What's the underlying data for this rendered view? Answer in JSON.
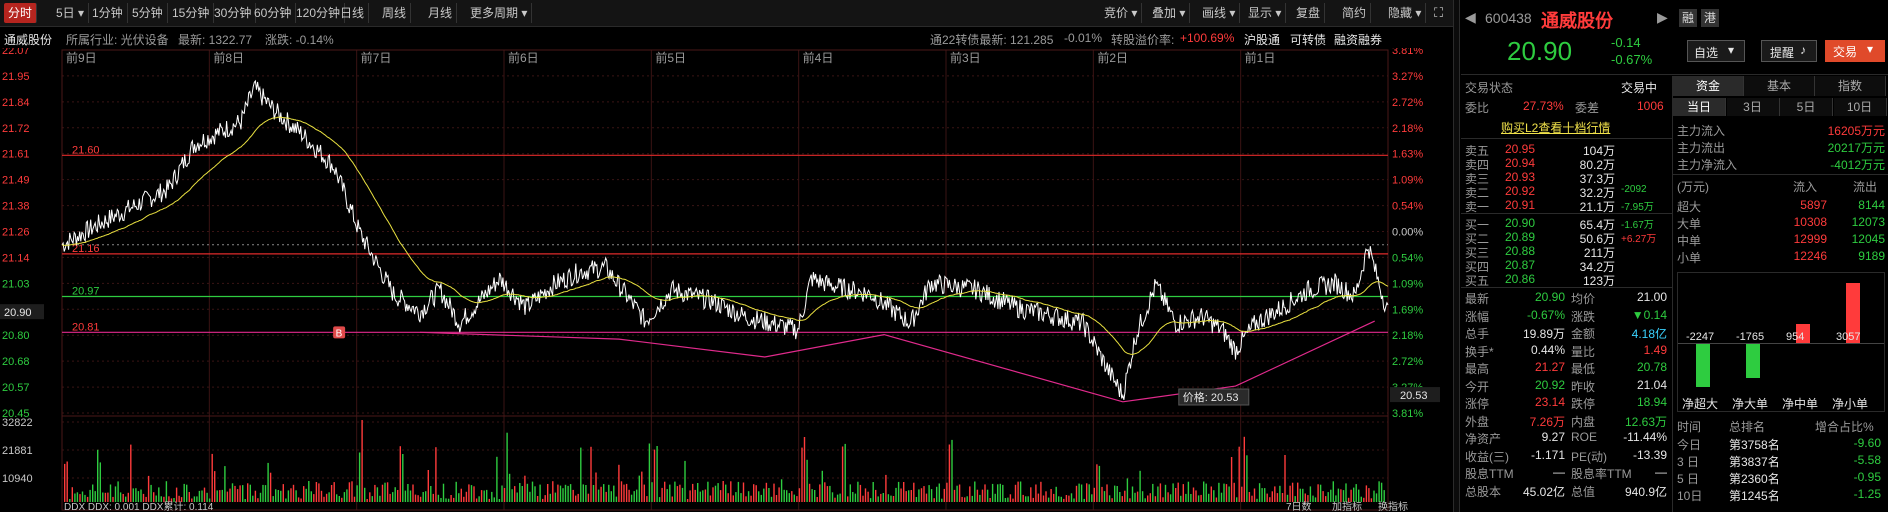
{
  "toolbar": {
    "left": [
      "分时",
      "5日",
      "1分钟",
      "5分钟",
      "15分钟",
      "30分钟",
      "60分钟",
      "120分钟",
      "日线",
      "周线",
      "月线",
      "更多周期"
    ],
    "right": [
      "竞价",
      "叠加",
      "画线",
      "显示",
      "复盘",
      "简约",
      "隐藏"
    ]
  },
  "infobar": {
    "name": "通威股份",
    "industry": "所属行业: 光伏设备",
    "latest": "最新: 1322.77",
    "change": "涨跌: -0.14%",
    "conv": "通22转债最新: 121.285",
    "conv_change": "-0.01%",
    "premium_label": "转股溢价率:",
    "premium": "+100.69%",
    "hk": "沪股通",
    "kz": "可转债",
    "rz": "融资融券"
  },
  "chart": {
    "day_labels": [
      "前9日",
      "前8日",
      "前7日",
      "前6日",
      "前5日",
      "前4日",
      "前3日",
      "前2日",
      "前1日"
    ],
    "price_ticks": [
      "22.07",
      "21.95",
      "21.84",
      "21.72",
      "21.61",
      "21.49",
      "21.38",
      "21.26",
      "21.14",
      "21.03",
      "20.90",
      "20.80",
      "20.68",
      "20.57",
      "20.45"
    ],
    "pct_ticks": [
      "3.81%",
      "3.27%",
      "2.72%",
      "2.18%",
      "1.63%",
      "1.09%",
      "0.54%",
      "0.00%",
      "0.54%",
      "1.09%",
      "1.69%",
      "2.18%",
      "2.72%",
      "3.27%",
      "3.81%"
    ],
    "price_min": 20.45,
    "price_max": 22.07,
    "level_labels": [
      "21.60",
      "21.16",
      "20.97",
      "20.81"
    ],
    "current_price": "20.90",
    "cursor_price": "20.53",
    "tooltip": "价格: 20.53",
    "b_marker": "B",
    "vol_ticks": [
      "32822",
      "21881",
      "10940"
    ],
    "bottom_left": "DDX  DDX: 0.001  DDX累计: 0.114",
    "bottom_right": [
      "7日数",
      "加指标",
      "换指标"
    ],
    "colors": {
      "up": "#ff3b3b",
      "down": "#2ecc40",
      "avg": "#e8e040",
      "level_red": "#e02a2a",
      "level_green": "#2ecc40",
      "level_magenta": "#e02a8c"
    }
  },
  "stock": {
    "code": "600438",
    "name": "通威股份",
    "tag1": "融",
    "tag2": "港",
    "price": "20.90",
    "change": "-0.14",
    "change_pct": "-0.67%",
    "watch_btn": "自选",
    "alert_btn": "提醒",
    "trade_btn": "交易"
  },
  "status": {
    "label": "交易状态",
    "value": "交易中",
    "ratio_label": "委比",
    "ratio": "27.73%",
    "diff_label": "委差",
    "diff": "1006",
    "l2": "购买L2查看十档行情"
  },
  "asks": [
    {
      "label": "卖五",
      "price": "20.95",
      "vol": "104万",
      "delta": ""
    },
    {
      "label": "卖四",
      "price": "20.94",
      "vol": "80.2万",
      "delta": ""
    },
    {
      "label": "卖三",
      "price": "20.93",
      "vol": "37.3万",
      "delta": ""
    },
    {
      "label": "卖二",
      "price": "20.92",
      "vol": "32.2万",
      "delta": "-2092"
    },
    {
      "label": "卖一",
      "price": "20.91",
      "vol": "21.1万",
      "delta": "-7.95万"
    }
  ],
  "bids": [
    {
      "label": "买一",
      "price": "20.90",
      "vol": "65.4万",
      "delta": "-1.67万"
    },
    {
      "label": "买二",
      "price": "20.89",
      "vol": "50.6万",
      "delta": "+6.27万"
    },
    {
      "label": "买三",
      "price": "20.88",
      "vol": "211万",
      "delta": ""
    },
    {
      "label": "买四",
      "price": "20.87",
      "vol": "34.2万",
      "delta": ""
    },
    {
      "label": "买五",
      "price": "20.86",
      "vol": "123万",
      "delta": ""
    }
  ],
  "quote": [
    {
      "l1": "最新",
      "v1": "20.90",
      "c1": "green",
      "l2": "均价",
      "v2": "21.00",
      "c2": "white"
    },
    {
      "l1": "涨幅",
      "v1": "-0.67%",
      "c1": "green",
      "l2": "涨跌",
      "v2": "▼0.14",
      "c2": "green"
    },
    {
      "l1": "总手",
      "v1": "19.89万",
      "c1": "white",
      "l2": "金额",
      "v2": "4.18亿",
      "c2": "cyan"
    },
    {
      "l1": "换手*",
      "v1": "0.44%",
      "c1": "white",
      "l2": "量比",
      "v2": "1.49",
      "c2": "red"
    },
    {
      "l1": "最高",
      "v1": "21.27",
      "c1": "red",
      "l2": "最低",
      "v2": "20.78",
      "c2": "green"
    },
    {
      "l1": "今开",
      "v1": "20.92",
      "c1": "green",
      "l2": "昨收",
      "v2": "21.04",
      "c2": "white"
    },
    {
      "l1": "涨停",
      "v1": "23.14",
      "c1": "red",
      "l2": "跌停",
      "v2": "18.94",
      "c2": "green"
    },
    {
      "l1": "外盘",
      "v1": "7.26万",
      "c1": "red",
      "l2": "内盘",
      "v2": "12.63万",
      "c2": "green"
    },
    {
      "l1": "净资产",
      "v1": "9.27",
      "c1": "white",
      "l2": "ROE",
      "v2": "-11.44%",
      "c2": "white"
    },
    {
      "l1": "收益(三)",
      "v1": "-1.171",
      "c1": "white",
      "l2": "PE(动)",
      "v2": "-13.39",
      "c2": "white"
    },
    {
      "l1": "股息TTM",
      "v1": "—",
      "c1": "white",
      "l2": "股息率TTM",
      "v2": "—",
      "c2": "white"
    },
    {
      "l1": "总股本",
      "v1": "45.02亿",
      "c1": "white",
      "l2": "总值",
      "v2": "940.9亿",
      "c2": "white"
    }
  ],
  "fund": {
    "tabs": [
      "资金",
      "基本",
      "指数"
    ],
    "periods": [
      "当日",
      "3日",
      "5日",
      "10日"
    ],
    "flows": [
      {
        "label": "主力流入",
        "value": "16205万元",
        "color": "red"
      },
      {
        "label": "主力流出",
        "value": "20217万元",
        "color": "green"
      },
      {
        "label": "主力净流入",
        "value": "-4012万元",
        "color": "green"
      }
    ],
    "unit": "(万元)",
    "in_label": "流入",
    "out_label": "流出",
    "rows": [
      {
        "label": "超大",
        "in": "5897",
        "out": "8144"
      },
      {
        "label": "大单",
        "in": "10308",
        "out": "12073"
      },
      {
        "label": "中单",
        "in": "12999",
        "out": "12045"
      },
      {
        "label": "小单",
        "in": "12246",
        "out": "9189"
      }
    ],
    "net": [
      {
        "label": "净超大",
        "value": -2247,
        "text": "-2247"
      },
      {
        "label": "净大单",
        "value": -1765,
        "text": "-1765"
      },
      {
        "label": "净中单",
        "value": 954,
        "text": "954"
      },
      {
        "label": "净小单",
        "value": 3057,
        "text": "3057"
      }
    ],
    "rank_header": [
      "时间",
      "总排名",
      "增合占比%"
    ],
    "ranks": [
      {
        "t": "今日",
        "r": "第3758名",
        "p": "-9.60"
      },
      {
        "t": "3 日",
        "r": "第3837名",
        "p": "-5.58"
      },
      {
        "t": "5 日",
        "r": "第2360名",
        "p": "-0.95"
      },
      {
        "t": "10日",
        "r": "第1245名",
        "p": "-1.25"
      }
    ]
  }
}
